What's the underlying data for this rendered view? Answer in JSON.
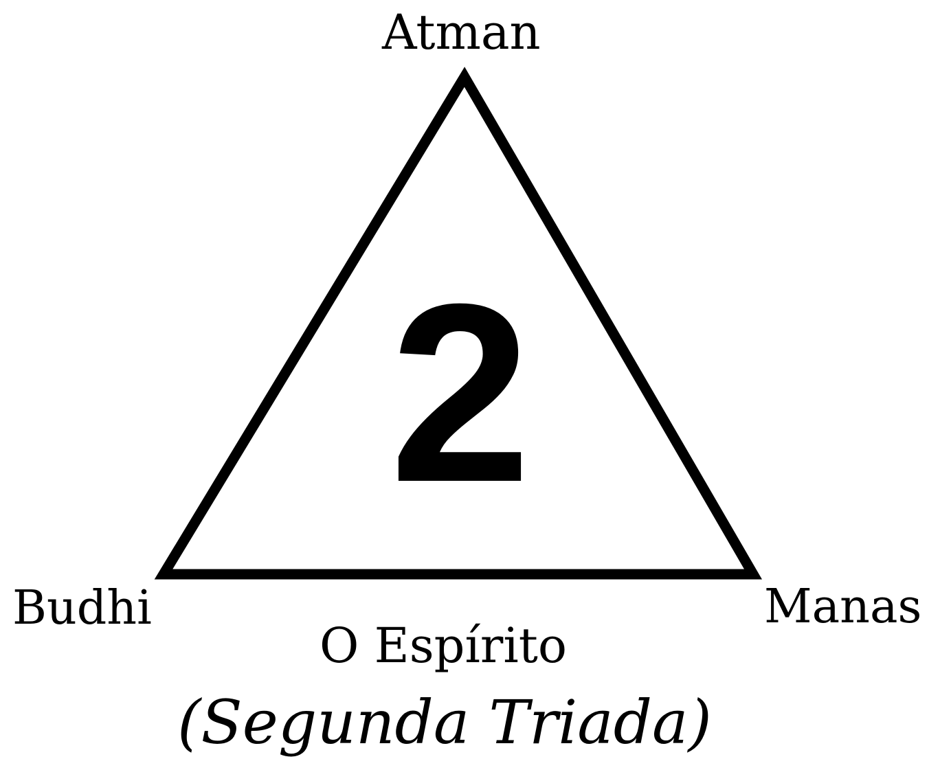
{
  "diagram": {
    "vertices": {
      "top": "Atman",
      "left": "Budhi",
      "right": "Manas"
    },
    "center_number": "2",
    "caption": {
      "main": "O Espírito",
      "sub": "(Segunda Triada)"
    },
    "colors": {
      "stroke": "#000000",
      "background": "#ffffff"
    }
  }
}
